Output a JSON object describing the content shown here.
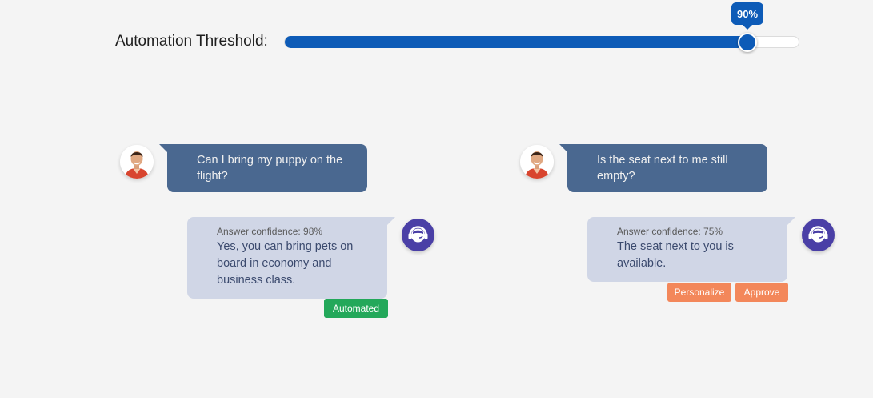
{
  "threshold": {
    "label": "Automation Threshold:",
    "value_percent": 90,
    "display": "90%"
  },
  "colors": {
    "accent": "#0d5bb7",
    "user_bubble": "#4a6890",
    "bot_bubble": "#d0d6e6",
    "automated": "#23a85a",
    "action": "#f3875a",
    "bot_avatar": "#4a3fa6"
  },
  "conversations": [
    {
      "question": "Can I bring my puppy on the flight?",
      "confidence": "Answer confidence: 98%",
      "answer": "Yes, you can bring pets on board in economy and business class.",
      "status": "Automated"
    },
    {
      "question": "Is the seat next to me still empty?",
      "confidence": "Answer confidence: 75%",
      "answer": "The seat next to you is available.",
      "actions": [
        "Personalize",
        "Approve"
      ]
    }
  ],
  "icons": {
    "user_avatar": "user-avatar-icon",
    "bot_avatar": "support-agent-icon"
  }
}
